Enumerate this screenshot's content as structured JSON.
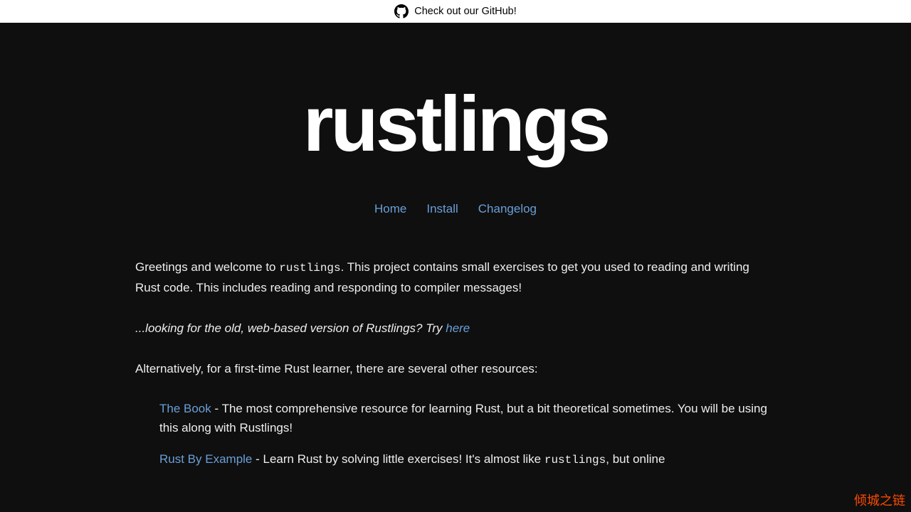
{
  "banner": {
    "text": "Check out our GitHub!"
  },
  "logo": {
    "text": "rustlings"
  },
  "nav": {
    "home": "Home",
    "install": "Install",
    "changelog": "Changelog"
  },
  "content": {
    "intro_before_code": "Greetings and welcome to ",
    "intro_code": "rustlings",
    "intro_after_code": ". This project contains small exercises to get you used to reading and writing Rust code. This includes reading and responding to compiler messages!",
    "looking_text": "...looking for the old, web-based version of Rustlings? Try ",
    "looking_link": "here",
    "alt_intro": "Alternatively, for a first-time Rust learner, there are several other resources:",
    "resources": [
      {
        "link": "The Book",
        "desc": " - The most comprehensive resource for learning Rust, but a bit theoretical sometimes. You will be using this along with Rustlings!"
      },
      {
        "link": "Rust By Example",
        "before_code": " - Learn Rust by solving little exercises! It's almost like ",
        "code": "rustlings",
        "after_code": ", but online"
      }
    ]
  },
  "watermark": "倾城之链"
}
